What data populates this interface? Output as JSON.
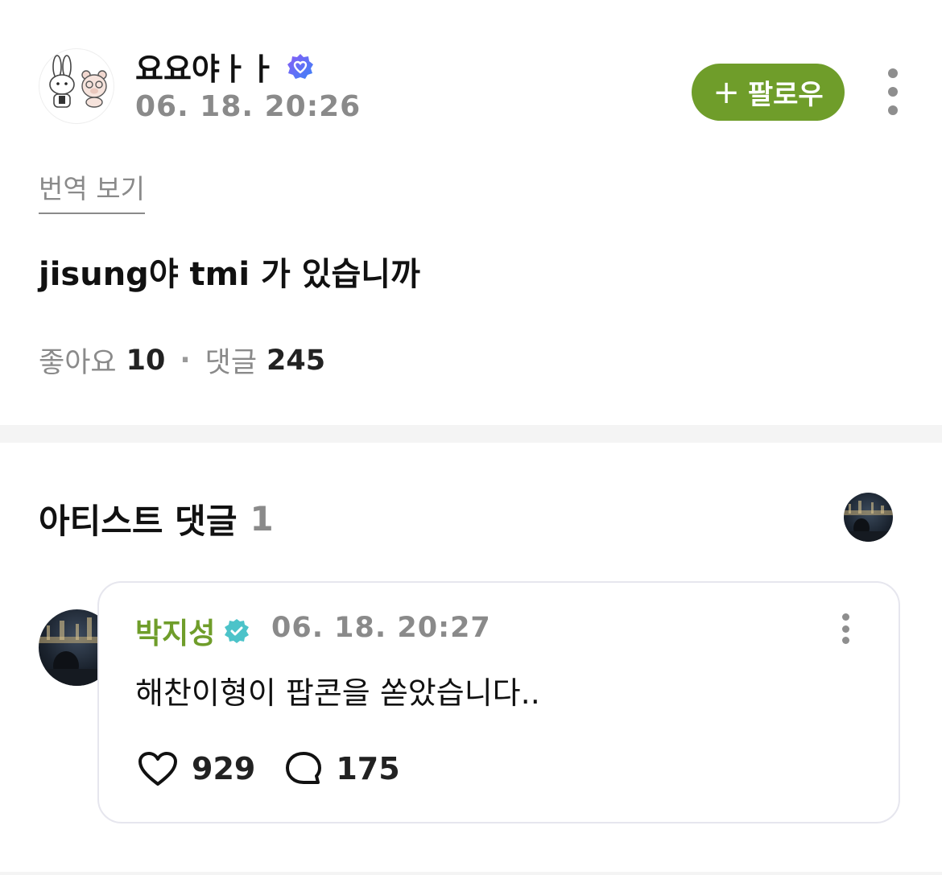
{
  "post": {
    "username": "요요야ㅏㅏ",
    "timestamp": "06. 18. 20:26",
    "follow_label": "팔로우",
    "follow_icon": "plus-icon",
    "translate_label": "번역 보기",
    "body": "jisung야 tmi 가 있습니까",
    "likes_label": "좋아요",
    "likes_count": "10",
    "separator": "·",
    "comments_label": "댓글",
    "comments_count": "245"
  },
  "artist_section": {
    "title": "아티스트 댓글",
    "count": "1"
  },
  "comment": {
    "author": "박지성",
    "timestamp": "06. 18. 20:27",
    "text": "해찬이형이 팝콘을 쏟았습니다..",
    "likes": "929",
    "replies": "175"
  },
  "colors": {
    "accent_green": "#6f9d2a",
    "muted_gray": "#8a8a8a",
    "verified_blue": "#5a6cf0",
    "artist_badge_teal": "#4cc3c9"
  }
}
